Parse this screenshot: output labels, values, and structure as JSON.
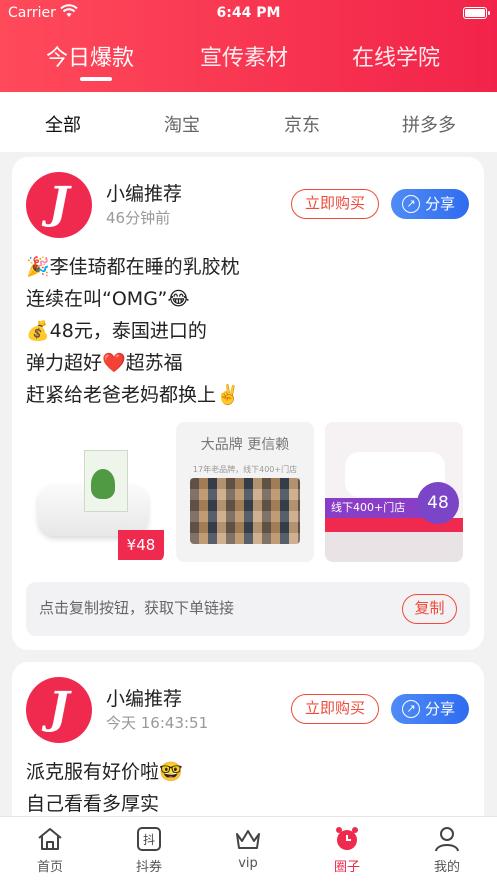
{
  "status_bar": {
    "carrier": "Carrier",
    "time": "6:44 PM"
  },
  "top_tabs": [
    {
      "label": "今日爆款",
      "active": true
    },
    {
      "label": "宣传素材",
      "active": false
    },
    {
      "label": "在线学院",
      "active": false
    }
  ],
  "sub_tabs": [
    {
      "label": "全部",
      "active": true
    },
    {
      "label": "淘宝",
      "active": false
    },
    {
      "label": "京东",
      "active": false
    },
    {
      "label": "拼多多",
      "active": false
    }
  ],
  "posts": [
    {
      "avatar_letter": "J",
      "author": "小编推荐",
      "time": "46分钟前",
      "buy_label": "立即购买",
      "share_label": "分享",
      "lines": [
        "🎉李佳琦都在睡的乳胶枕",
        "连续在叫“OMG”😂",
        "💰48元，泰国进口的",
        "弹力超好❤️超苏福",
        "赶紧给老爸老妈都换上✌️"
      ],
      "images": {
        "price_tag": "¥48",
        "brand_title": "大品牌 更信赖",
        "brand_sub": "17年老品牌，线下400+门店",
        "promo_band": "线下400+门店",
        "promo_price": "48"
      },
      "copy_hint": "点击复制按钮，获取下单链接",
      "copy_label": "复制"
    },
    {
      "avatar_letter": "J",
      "author": "小编推荐",
      "time": "今天 16:43:51",
      "buy_label": "立即购买",
      "share_label": "分享",
      "lines": [
        "派克服有好价啦🤓",
        "自己看看多厚实"
      ]
    }
  ],
  "tab_bar": [
    {
      "label": "首页",
      "icon": "home-icon",
      "active": false
    },
    {
      "label": "抖券",
      "icon": "douquan-icon",
      "active": false
    },
    {
      "label": "vip",
      "icon": "crown-icon",
      "active": false
    },
    {
      "label": "圈子",
      "icon": "alarm-clock-icon",
      "active": true
    },
    {
      "label": "我的",
      "icon": "person-icon",
      "active": false
    }
  ],
  "colors": {
    "brand": "#f0294e",
    "share": "#3a78f2",
    "buy_border": "#f04a3a"
  }
}
